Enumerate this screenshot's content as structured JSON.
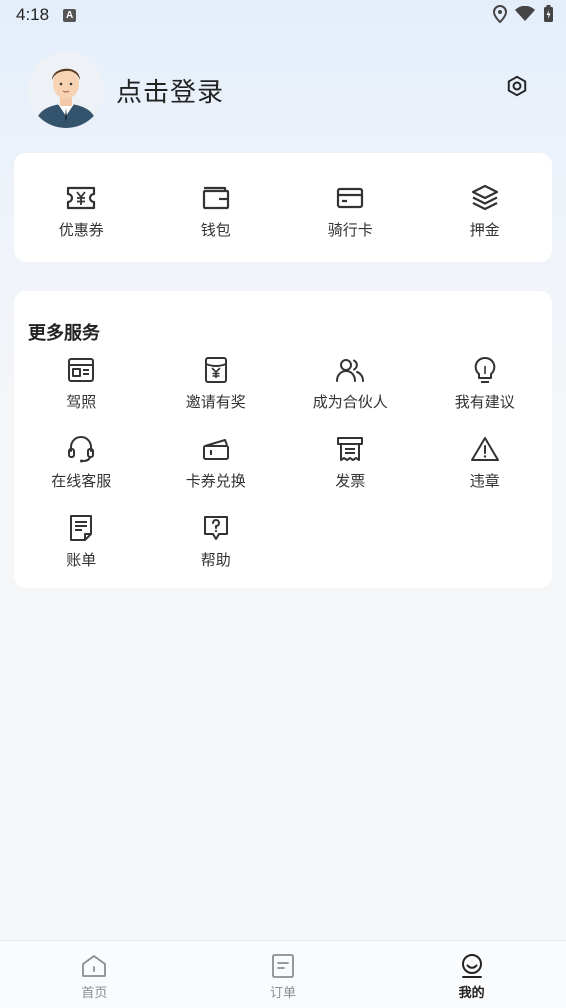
{
  "status_bar": {
    "time": "4:18",
    "notification_glyph": "A",
    "icons": [
      "location-icon",
      "wifi-icon",
      "battery-icon"
    ]
  },
  "profile": {
    "login_text": "点击登录",
    "avatar": "avatar-icon",
    "settings_icon": "gear-icon"
  },
  "top_menu": [
    {
      "label": "优惠券",
      "icon": "coupon-icon"
    },
    {
      "label": "钱包",
      "icon": "wallet-icon"
    },
    {
      "label": "骑行卡",
      "icon": "card-icon"
    },
    {
      "label": "押金",
      "icon": "layers-icon"
    }
  ],
  "more_services": {
    "title": "更多服务",
    "items": [
      {
        "label": "驾照",
        "icon": "license-icon"
      },
      {
        "label": "邀请有奖",
        "icon": "invite-icon"
      },
      {
        "label": "成为合伙人",
        "icon": "users-icon"
      },
      {
        "label": "我有建议",
        "icon": "lightbulb-icon"
      },
      {
        "label": "在线客服",
        "icon": "headset-icon"
      },
      {
        "label": "卡券兑换",
        "icon": "ticket-icon"
      },
      {
        "label": "发票",
        "icon": "invoice-icon"
      },
      {
        "label": "违章",
        "icon": "warning-icon"
      },
      {
        "label": "账单",
        "icon": "bill-icon"
      },
      {
        "label": "帮助",
        "icon": "help-icon"
      }
    ]
  },
  "tabbar": {
    "active": "我的",
    "tabs": [
      {
        "label": "首页",
        "icon": "home-icon"
      },
      {
        "label": "订单",
        "icon": "order-icon"
      },
      {
        "label": "我的",
        "icon": "profile-icon"
      }
    ]
  },
  "colors": {
    "accent_bg": "#e4eefb",
    "text": "#222222",
    "inactive": "#8a8d92"
  }
}
